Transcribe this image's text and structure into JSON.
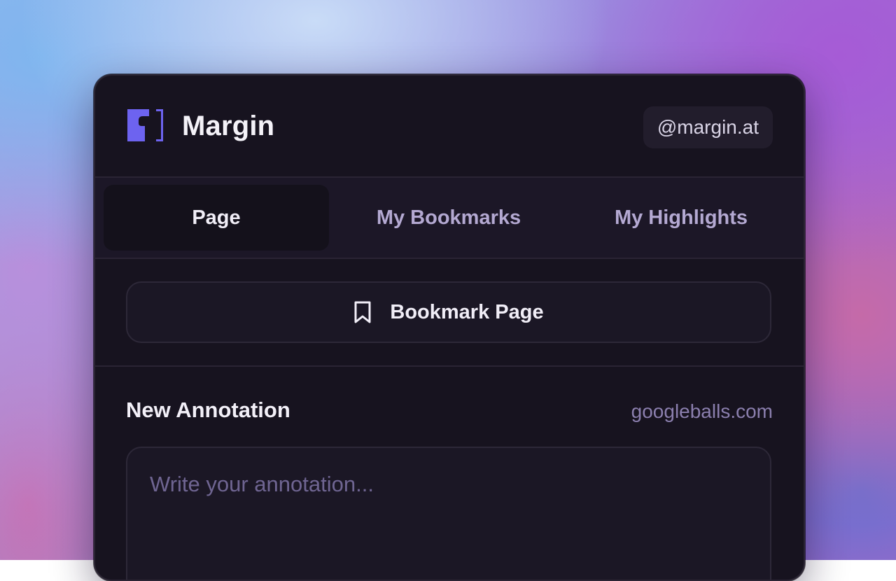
{
  "header": {
    "brand": "Margin",
    "handle": "@margin.at"
  },
  "tabs": [
    {
      "label": "Page",
      "active": true
    },
    {
      "label": "My Bookmarks",
      "active": false
    },
    {
      "label": "My Highlights",
      "active": false
    }
  ],
  "bookmark": {
    "label": "Bookmark Page",
    "icon": "bookmark-icon"
  },
  "annotation": {
    "title": "New Annotation",
    "domain": "googleballs.com",
    "placeholder": "Write your annotation..."
  },
  "colors": {
    "accent": "#6d63f0",
    "panel_background": "#17131f",
    "tab_bar_background": "#1c1727",
    "muted_text": "#8b7fae"
  }
}
